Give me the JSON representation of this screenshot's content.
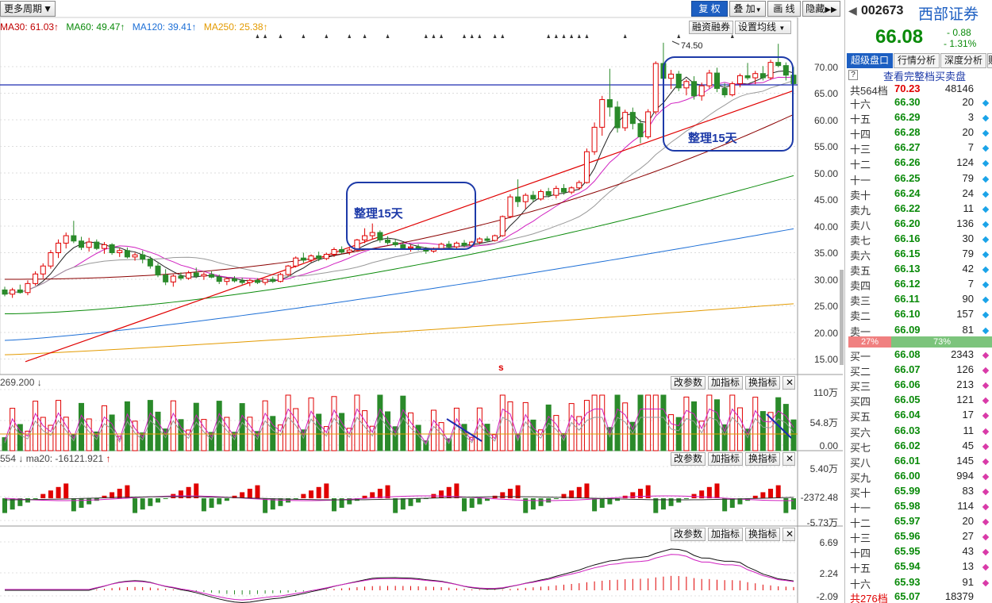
{
  "toolbar": {
    "period_label": "更多周期",
    "buttons_right": [
      "复 权",
      "叠 加",
      "画 线",
      "隐藏"
    ]
  },
  "ma_legend": [
    {
      "text": "MA30: 61.03",
      "arrow": "↑",
      "color": "#c00000"
    },
    {
      "text": "MA60: 49.47",
      "arrow": "↑",
      "color": "#0a8a0a"
    },
    {
      "text": "MA120: 39.41",
      "arrow": "↑",
      "color": "#1d6fd6"
    },
    {
      "text": "MA250: 25.38",
      "arrow": "↑",
      "color": "#e39a00"
    }
  ],
  "overlay_buttons": {
    "margin": "融资融券",
    "ma_setting": "设置均线"
  },
  "peak_label": "74.50",
  "annotations": {
    "box1": "整理15天",
    "box2": "整理15天"
  },
  "price_axis": [
    "70.00",
    "65.00",
    "60.00",
    "55.00",
    "50.00",
    "45.00",
    "40.00",
    "35.00",
    "30.00",
    "25.00",
    "20.00",
    "15.00"
  ],
  "s_marker": "s",
  "vol_panel": {
    "legend": "269.200",
    "legend_arrow": "↓",
    "axis": [
      "110万",
      "54.8万",
      "0.00"
    ]
  },
  "flow_panel": {
    "legend_a": "554",
    "legend_a_arrow": "↓",
    "legend_b": "ma20: -16121.921",
    "legend_b_arrow": "↑",
    "axis": [
      "5.40万",
      "-2372.48",
      "-5.73万"
    ]
  },
  "macd_panel": {
    "axis": [
      "6.69",
      "2.24",
      "-2.09"
    ]
  },
  "panel_buttons": {
    "params": "改参数",
    "add": "加指标",
    "swap": "换指标",
    "close": "✕"
  },
  "quote": {
    "code": "002673",
    "name": "西部证券",
    "price": "66.08",
    "change": "- 0.88",
    "change_pct": "- 1.31%",
    "tabs": [
      "超级盘口",
      "行情分析",
      "深度分析",
      "财"
    ],
    "link": "查看完整档买卖盘",
    "sell_total": {
      "label": "共564档",
      "price": "70.23",
      "vol": "48146"
    },
    "buy_total": {
      "label": "共276档",
      "price": "65.07",
      "vol": "18379"
    },
    "ratio": {
      "sell": "27%",
      "buy": "73%"
    },
    "sells": [
      {
        "name": "十六",
        "price": "66.30",
        "vol": "20"
      },
      {
        "name": "十五",
        "price": "66.29",
        "vol": "3"
      },
      {
        "name": "十四",
        "price": "66.28",
        "vol": "20"
      },
      {
        "name": "十三",
        "price": "66.27",
        "vol": "7"
      },
      {
        "name": "十二",
        "price": "66.26",
        "vol": "124"
      },
      {
        "name": "十一",
        "price": "66.25",
        "vol": "79"
      },
      {
        "name": "卖十",
        "price": "66.24",
        "vol": "24"
      },
      {
        "name": "卖九",
        "price": "66.22",
        "vol": "11"
      },
      {
        "name": "卖八",
        "price": "66.20",
        "vol": "136"
      },
      {
        "name": "卖七",
        "price": "66.16",
        "vol": "30"
      },
      {
        "name": "卖六",
        "price": "66.15",
        "vol": "79"
      },
      {
        "name": "卖五",
        "price": "66.13",
        "vol": "42"
      },
      {
        "name": "卖四",
        "price": "66.12",
        "vol": "7"
      },
      {
        "name": "卖三",
        "price": "66.11",
        "vol": "90"
      },
      {
        "name": "卖二",
        "price": "66.10",
        "vol": "157"
      },
      {
        "name": "卖一",
        "price": "66.09",
        "vol": "81"
      }
    ],
    "buys": [
      {
        "name": "买一",
        "price": "66.08",
        "vol": "2343"
      },
      {
        "name": "买二",
        "price": "66.07",
        "vol": "126"
      },
      {
        "name": "买三",
        "price": "66.06",
        "vol": "213"
      },
      {
        "name": "买四",
        "price": "66.05",
        "vol": "121"
      },
      {
        "name": "买五",
        "price": "66.04",
        "vol": "17"
      },
      {
        "name": "买六",
        "price": "66.03",
        "vol": "11"
      },
      {
        "name": "买七",
        "price": "66.02",
        "vol": "45"
      },
      {
        "name": "买八",
        "price": "66.01",
        "vol": "145"
      },
      {
        "name": "买九",
        "price": "66.00",
        "vol": "994"
      },
      {
        "name": "买十",
        "price": "65.99",
        "vol": "83"
      },
      {
        "name": "十一",
        "price": "65.98",
        "vol": "114"
      },
      {
        "name": "十二",
        "price": "65.97",
        "vol": "20"
      },
      {
        "name": "十三",
        "price": "65.96",
        "vol": "27"
      },
      {
        "name": "十四",
        "price": "65.95",
        "vol": "43"
      },
      {
        "name": "十五",
        "price": "65.94",
        "vol": "13"
      },
      {
        "name": "十六",
        "price": "65.93",
        "vol": "91"
      }
    ]
  },
  "colors": {
    "up": "#e00000",
    "down": "#2a8a2a",
    "accent": "#1d5fc2",
    "quote_green": "#0a8a0a"
  },
  "candles": [
    [
      28.0,
      28.6,
      26.8,
      27.2
    ],
    [
      27.2,
      28.4,
      26.5,
      28.0
    ],
    [
      28.0,
      29.0,
      27.3,
      27.5
    ],
    [
      27.5,
      29.8,
      27.0,
      29.2
    ],
    [
      29.2,
      31.5,
      28.8,
      31.0
    ],
    [
      31.0,
      33.0,
      30.2,
      32.5
    ],
    [
      32.5,
      35.5,
      32.0,
      35.0
    ],
    [
      35.0,
      37.5,
      34.0,
      36.8
    ],
    [
      36.8,
      38.8,
      35.8,
      38.2
    ],
    [
      38.2,
      41.0,
      36.8,
      37.2
    ],
    [
      37.2,
      38.0,
      35.5,
      36.0
    ],
    [
      36.0,
      37.8,
      35.2,
      37.0
    ],
    [
      37.0,
      37.5,
      35.5,
      35.8
    ],
    [
      35.8,
      37.0,
      34.8,
      36.5
    ],
    [
      36.5,
      36.8,
      34.6,
      35.0
    ],
    [
      35.0,
      35.8,
      34.2,
      35.4
    ],
    [
      35.4,
      36.0,
      33.9,
      34.2
    ],
    [
      34.2,
      35.0,
      33.5,
      34.6
    ],
    [
      34.6,
      35.4,
      33.0,
      33.8
    ],
    [
      33.8,
      34.3,
      32.0,
      32.5
    ],
    [
      32.5,
      33.0,
      30.4,
      30.8
    ],
    [
      30.8,
      31.9,
      28.9,
      29.5
    ],
    [
      29.5,
      30.9,
      28.6,
      30.6
    ],
    [
      30.6,
      31.3,
      29.8,
      30.2
    ],
    [
      30.2,
      31.6,
      29.9,
      31.2
    ],
    [
      31.2,
      32.2,
      30.2,
      30.6
    ],
    [
      30.6,
      31.3,
      29.9,
      30.9
    ],
    [
      30.9,
      31.5,
      30.2,
      30.4
    ],
    [
      30.4,
      30.9,
      29.1,
      29.6
    ],
    [
      29.6,
      30.4,
      28.9,
      30.1
    ],
    [
      30.1,
      30.6,
      29.4,
      29.7
    ],
    [
      29.7,
      30.3,
      29.0,
      29.4
    ],
    [
      29.4,
      30.1,
      28.7,
      29.8
    ],
    [
      29.8,
      30.2,
      29.1,
      29.4
    ],
    [
      29.4,
      30.1,
      28.9,
      30.0
    ],
    [
      30.0,
      30.5,
      29.3,
      29.6
    ],
    [
      29.6,
      31.2,
      29.4,
      30.9
    ],
    [
      30.9,
      32.7,
      30.6,
      32.5
    ],
    [
      32.5,
      34.3,
      32.2,
      34.0
    ],
    [
      34.0,
      35.0,
      33.1,
      33.6
    ],
    [
      33.6,
      34.7,
      33.2,
      34.4
    ],
    [
      34.4,
      35.2,
      33.4,
      33.9
    ],
    [
      33.9,
      35.0,
      33.6,
      34.7
    ],
    [
      34.7,
      36.0,
      34.2,
      35.6
    ],
    [
      35.6,
      36.2,
      34.8,
      35.1
    ],
    [
      35.1,
      35.9,
      34.6,
      35.5
    ],
    [
      35.5,
      37.6,
      35.2,
      37.4
    ],
    [
      37.4,
      39.6,
      36.8,
      38.2
    ],
    [
      38.2,
      40.5,
      37.6,
      38.8
    ],
    [
      38.8,
      39.2,
      36.9,
      37.4
    ],
    [
      37.4,
      38.1,
      36.5,
      36.9
    ],
    [
      36.9,
      37.6,
      36.1,
      36.5
    ],
    [
      36.5,
      37.0,
      35.6,
      35.9
    ],
    [
      35.9,
      36.5,
      35.2,
      36.1
    ],
    [
      36.1,
      36.6,
      35.4,
      35.6
    ],
    [
      35.6,
      36.1,
      34.8,
      35.3
    ],
    [
      35.3,
      36.0,
      35.0,
      35.8
    ],
    [
      35.8,
      36.9,
      35.5,
      36.6
    ],
    [
      36.6,
      37.2,
      35.9,
      36.1
    ],
    [
      36.1,
      37.1,
      35.8,
      36.8
    ],
    [
      36.8,
      37.4,
      36.0,
      36.4
    ],
    [
      36.4,
      37.2,
      36.1,
      37.0
    ],
    [
      37.0,
      37.9,
      36.6,
      37.6
    ],
    [
      37.6,
      38.1,
      37.0,
      37.3
    ],
    [
      37.3,
      38.4,
      37.1,
      38.2
    ],
    [
      38.2,
      42.0,
      38.0,
      41.8
    ],
    [
      41.8,
      46.0,
      41.5,
      45.5
    ],
    [
      45.5,
      48.8,
      43.6,
      44.6
    ],
    [
      44.6,
      46.2,
      43.2,
      45.8
    ],
    [
      45.8,
      46.6,
      44.6,
      45.1
    ],
    [
      45.1,
      46.9,
      44.8,
      46.5
    ],
    [
      46.5,
      47.2,
      45.4,
      45.8
    ],
    [
      45.8,
      47.6,
      45.2,
      47.1
    ],
    [
      47.1,
      47.9,
      45.9,
      46.4
    ],
    [
      46.4,
      47.5,
      46.0,
      47.2
    ],
    [
      47.2,
      48.6,
      46.8,
      48.2
    ],
    [
      48.2,
      54.6,
      48.0,
      54.0
    ],
    [
      54.0,
      59.5,
      53.4,
      58.6
    ],
    [
      58.6,
      64.5,
      57.0,
      63.8
    ],
    [
      63.8,
      69.6,
      60.6,
      62.4
    ],
    [
      62.4,
      63.5,
      57.6,
      58.5
    ],
    [
      58.5,
      61.9,
      57.9,
      61.4
    ],
    [
      61.4,
      62.3,
      58.2,
      59.3
    ],
    [
      59.3,
      60.1,
      55.6,
      56.8
    ],
    [
      56.8,
      62.0,
      56.4,
      61.5
    ],
    [
      61.5,
      71.0,
      61.0,
      70.6
    ],
    [
      70.6,
      74.5,
      66.9,
      67.8
    ],
    [
      67.8,
      69.4,
      65.8,
      68.6
    ],
    [
      68.6,
      69.2,
      65.4,
      66.0
    ],
    [
      66.0,
      67.6,
      64.6,
      67.2
    ],
    [
      67.2,
      68.2,
      63.8,
      64.5
    ],
    [
      64.5,
      67.0,
      63.6,
      66.4
    ],
    [
      66.4,
      69.4,
      65.9,
      68.8
    ],
    [
      68.8,
      69.8,
      65.2,
      65.9
    ],
    [
      65.9,
      66.9,
      64.2,
      64.7
    ],
    [
      64.7,
      67.2,
      64.4,
      66.8
    ],
    [
      66.8,
      68.7,
      66.1,
      68.3
    ],
    [
      68.3,
      70.7,
      67.5,
      67.9
    ],
    [
      67.9,
      69.2,
      66.7,
      68.7
    ],
    [
      68.7,
      70.1,
      67.4,
      67.9
    ],
    [
      67.9,
      71.3,
      67.5,
      70.8
    ],
    [
      70.8,
      74.3,
      69.9,
      70.2
    ],
    [
      70.2,
      70.8,
      67.4,
      68.4
    ],
    [
      68.4,
      69.9,
      66.6,
      66.8
    ]
  ]
}
